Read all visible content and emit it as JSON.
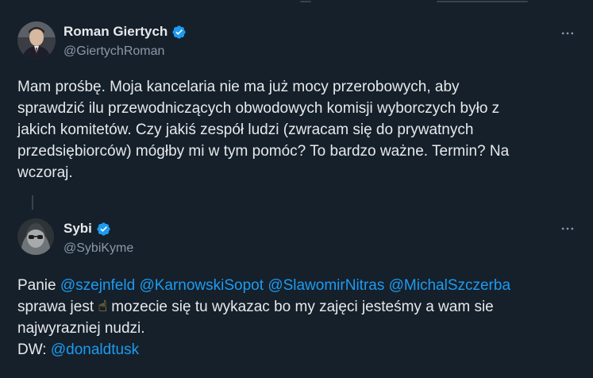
{
  "tweet1": {
    "name": "Roman Giertych",
    "handle": "@GiertychRoman",
    "lines": [
      "Mam prośbę. Moja kancelaria nie ma już mocy przerobowych, aby",
      "sprawdzić ilu przewodniczących obwodowych komisji wyborczych było z",
      "jakich komitetów. Czy jakiś zespół ludzi (zwracam się do prywatnych",
      "przedsiębiorców) mógłby mi w tym pomóc? To bardzo ważne. Termin? Na",
      "wczoraj."
    ]
  },
  "tweet2": {
    "name": "Sybi",
    "handle": "@SybiKyme",
    "line1": {
      "prefix": "Panie ",
      "mentions": [
        "@szejnfeld",
        "@KarnowskiSopot",
        "@SlawomirNitras",
        "@MichalSzczerba"
      ]
    },
    "line2": {
      "before": "sprawa jest ",
      "emoji": "☝",
      "after": " mozecie się tu wykazac bo my zajęci jesteśmy a wam sie"
    },
    "line3": "najwyrazniej nudzi.",
    "line4": {
      "label": "DW: ",
      "mention": "@donaldtusk"
    }
  },
  "colors": {
    "background": "#15202b",
    "text": "#e7e9ea",
    "secondary": "#8b98a5",
    "accent": "#1d9bf0"
  },
  "icons": [
    "verified-badge-icon",
    "more-options-icon"
  ]
}
